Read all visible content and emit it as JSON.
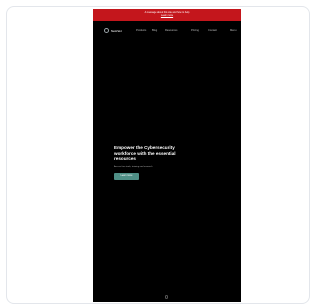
{
  "banner": {
    "text": "A message about this site and how to help",
    "link": "Learn more"
  },
  "nav": {
    "brand": "SemVer",
    "items": [
      "Products",
      "Blog",
      "Resources",
      "Pricing",
      "Contact",
      "Menu"
    ]
  },
  "hero": {
    "title": "Empower the Cybersecurity workforce with the essential resources",
    "subtitle": "Access free tools, training and research",
    "cta": "Learn more"
  },
  "colors": {
    "banner": "#c4161c",
    "background": "#000000",
    "cta": "#4f8f86"
  }
}
